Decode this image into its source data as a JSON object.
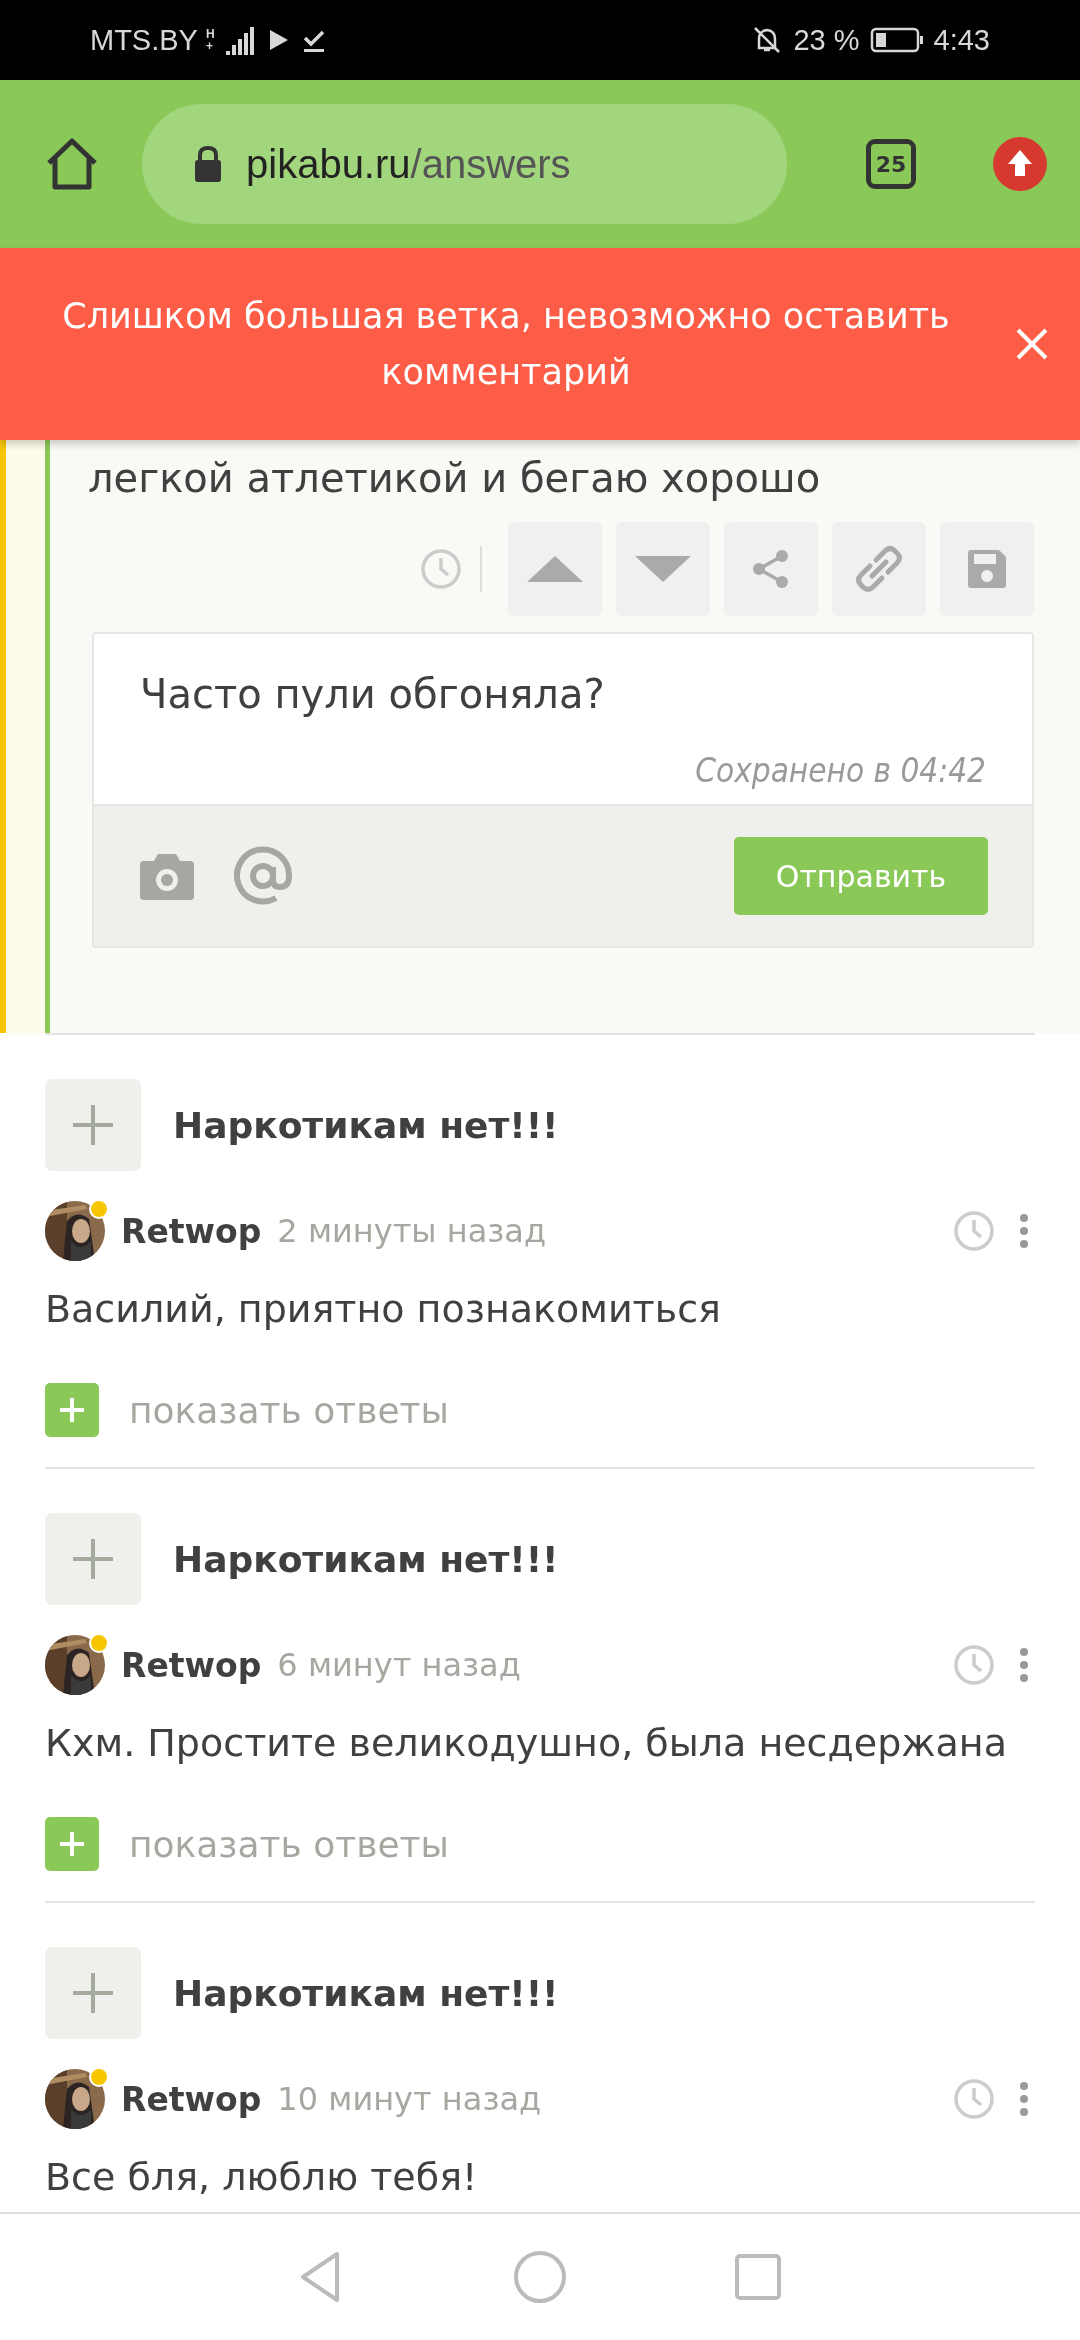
{
  "status_bar": {
    "carrier": "MTS.BY",
    "network": "H+",
    "battery": "23 %",
    "time": "4:43"
  },
  "browser": {
    "url_host": "pikabu.ru",
    "url_path": "/answers",
    "tab_count": "25"
  },
  "toast": {
    "message": "Слишком большая ветка, невозможно оставить комментарий"
  },
  "open_comment": {
    "text": "легкой атлетикой и бегаю хорошо",
    "reply": {
      "value": "Часто пули обгоняла?",
      "saved": "Сохранено в 04:42",
      "submit": "Отправить"
    }
  },
  "comments": [
    {
      "title": "Наркотикам нет!!!",
      "author": "Retwop",
      "time": "2 минуты назад",
      "text": "Василий, приятно познакомиться",
      "show_replies": "показать ответы"
    },
    {
      "title": "Наркотикам нет!!!",
      "author": "Retwop",
      "time": "6 минут назад",
      "text": "Кхм. Простите великодушно, была несдержана",
      "show_replies": "показать ответы"
    },
    {
      "title": "Наркотикам нет!!!",
      "author": "Retwop",
      "time": "10 минут назад",
      "text": "Все бля, люблю тебя!"
    }
  ]
}
